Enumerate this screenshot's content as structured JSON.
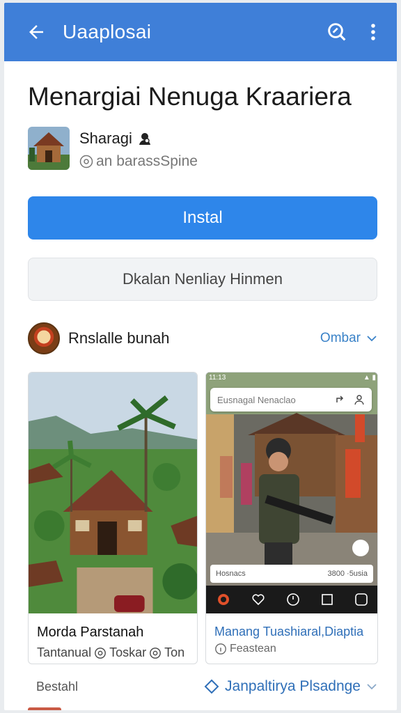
{
  "appbar": {
    "title": "Uaaplosai",
    "back_icon": "arrow-left-icon",
    "search_icon": "search-icon",
    "menu_icon": "more-vert-icon",
    "color": "#3f7fd8"
  },
  "app": {
    "heading": "Menargiai Nenuga Kraariera",
    "publisher_name": "Sharagi",
    "publisher_handle": "an barassSpine",
    "install_label": "Instal",
    "secondary_label": "Dkalan Nenliay Hinmen",
    "accent": "#2e86ea"
  },
  "section": {
    "label": "Rnslalle bunah",
    "more_label": "Ombar"
  },
  "cards": [
    {
      "title": "Morda Parstanah",
      "sub_a": "Tantanual",
      "sub_b": "Toskar",
      "sub_c": "Ton"
    },
    {
      "title": "Manang Tuashiaral,Diaptia",
      "sub": "Feastean",
      "phone": {
        "status_left": "11:13",
        "status_right": "▲ ▮",
        "search_text": "Eusnagal Nenaclao",
        "strip_left": "Hosnacs",
        "strip_right": "3800 ·5usia"
      }
    }
  ],
  "bottom": {
    "left_label": "Bestahl",
    "right_label": "Janpaltirya Plsadnge"
  }
}
